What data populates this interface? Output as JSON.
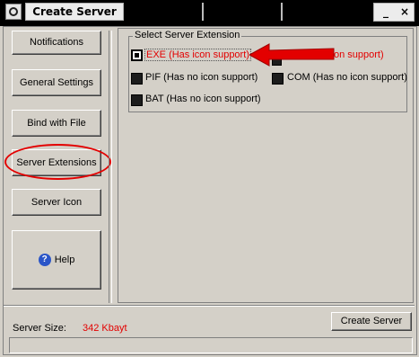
{
  "window": {
    "title": "Create Server",
    "minimize_label": "_",
    "close_label": "×"
  },
  "nav": {
    "items": [
      {
        "label": "Notifications"
      },
      {
        "label": "General Settings"
      },
      {
        "label": "Bind with File"
      },
      {
        "label": "Server Extensions"
      },
      {
        "label": "Server Icon"
      }
    ],
    "help_label": "Help"
  },
  "extensions": {
    "group_title": "Select Server Extension",
    "options": [
      {
        "label": "EXE (Has icon support)",
        "selected": true
      },
      {
        "label": "PIF (Has no icon support)",
        "selected": false
      },
      {
        "label": "COM (Has no icon support)",
        "selected": false
      },
      {
        "label": "BAT (Has no icon support)",
        "selected": false
      }
    ],
    "hidden_option_fragment": "on support)"
  },
  "footer": {
    "size_label": "Server Size:",
    "size_value": "342 Kbayt",
    "create_label": "Create Server",
    "progress": 0
  },
  "colors": {
    "accent_red": "#e30000",
    "face": "#d4d0c8",
    "titlebar": "#000000"
  }
}
